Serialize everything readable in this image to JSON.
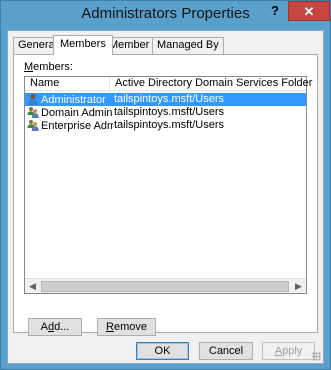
{
  "window": {
    "title": "Administrators Properties",
    "help_label": "?",
    "close_label": "✕"
  },
  "tabs": [
    {
      "label": "General",
      "active": false
    },
    {
      "label": "Members",
      "active": true
    },
    {
      "label": "Member Of",
      "active": false
    },
    {
      "label": "Managed By",
      "active": false
    }
  ],
  "members": {
    "label_prefix": "M",
    "label_rest": "embers:",
    "columns": [
      "Name",
      "Active Directory Domain Services Folder"
    ],
    "rows": [
      {
        "name": "Administrator",
        "folder": "tailspintoys.msft/Users",
        "icon": "user-icon",
        "selected": true
      },
      {
        "name": "Domain Admins",
        "folder": "tailspintoys.msft/Users",
        "icon": "group-icon",
        "selected": false
      },
      {
        "name": "Enterprise Admins",
        "folder": "tailspintoys.msft/Users",
        "icon": "group-icon",
        "selected": false
      }
    ]
  },
  "buttons": {
    "add_prefix": "A",
    "add_underlined": "d",
    "add_rest": "d...",
    "remove_prefix": "",
    "remove_underlined": "R",
    "remove_rest": "emove",
    "ok": "OK",
    "cancel": "Cancel",
    "apply_underlined": "A",
    "apply_rest": "pply"
  },
  "colors": {
    "title_bar": "#5aa0cc",
    "close_button": "#c7463f",
    "selection": "#3399ff"
  }
}
